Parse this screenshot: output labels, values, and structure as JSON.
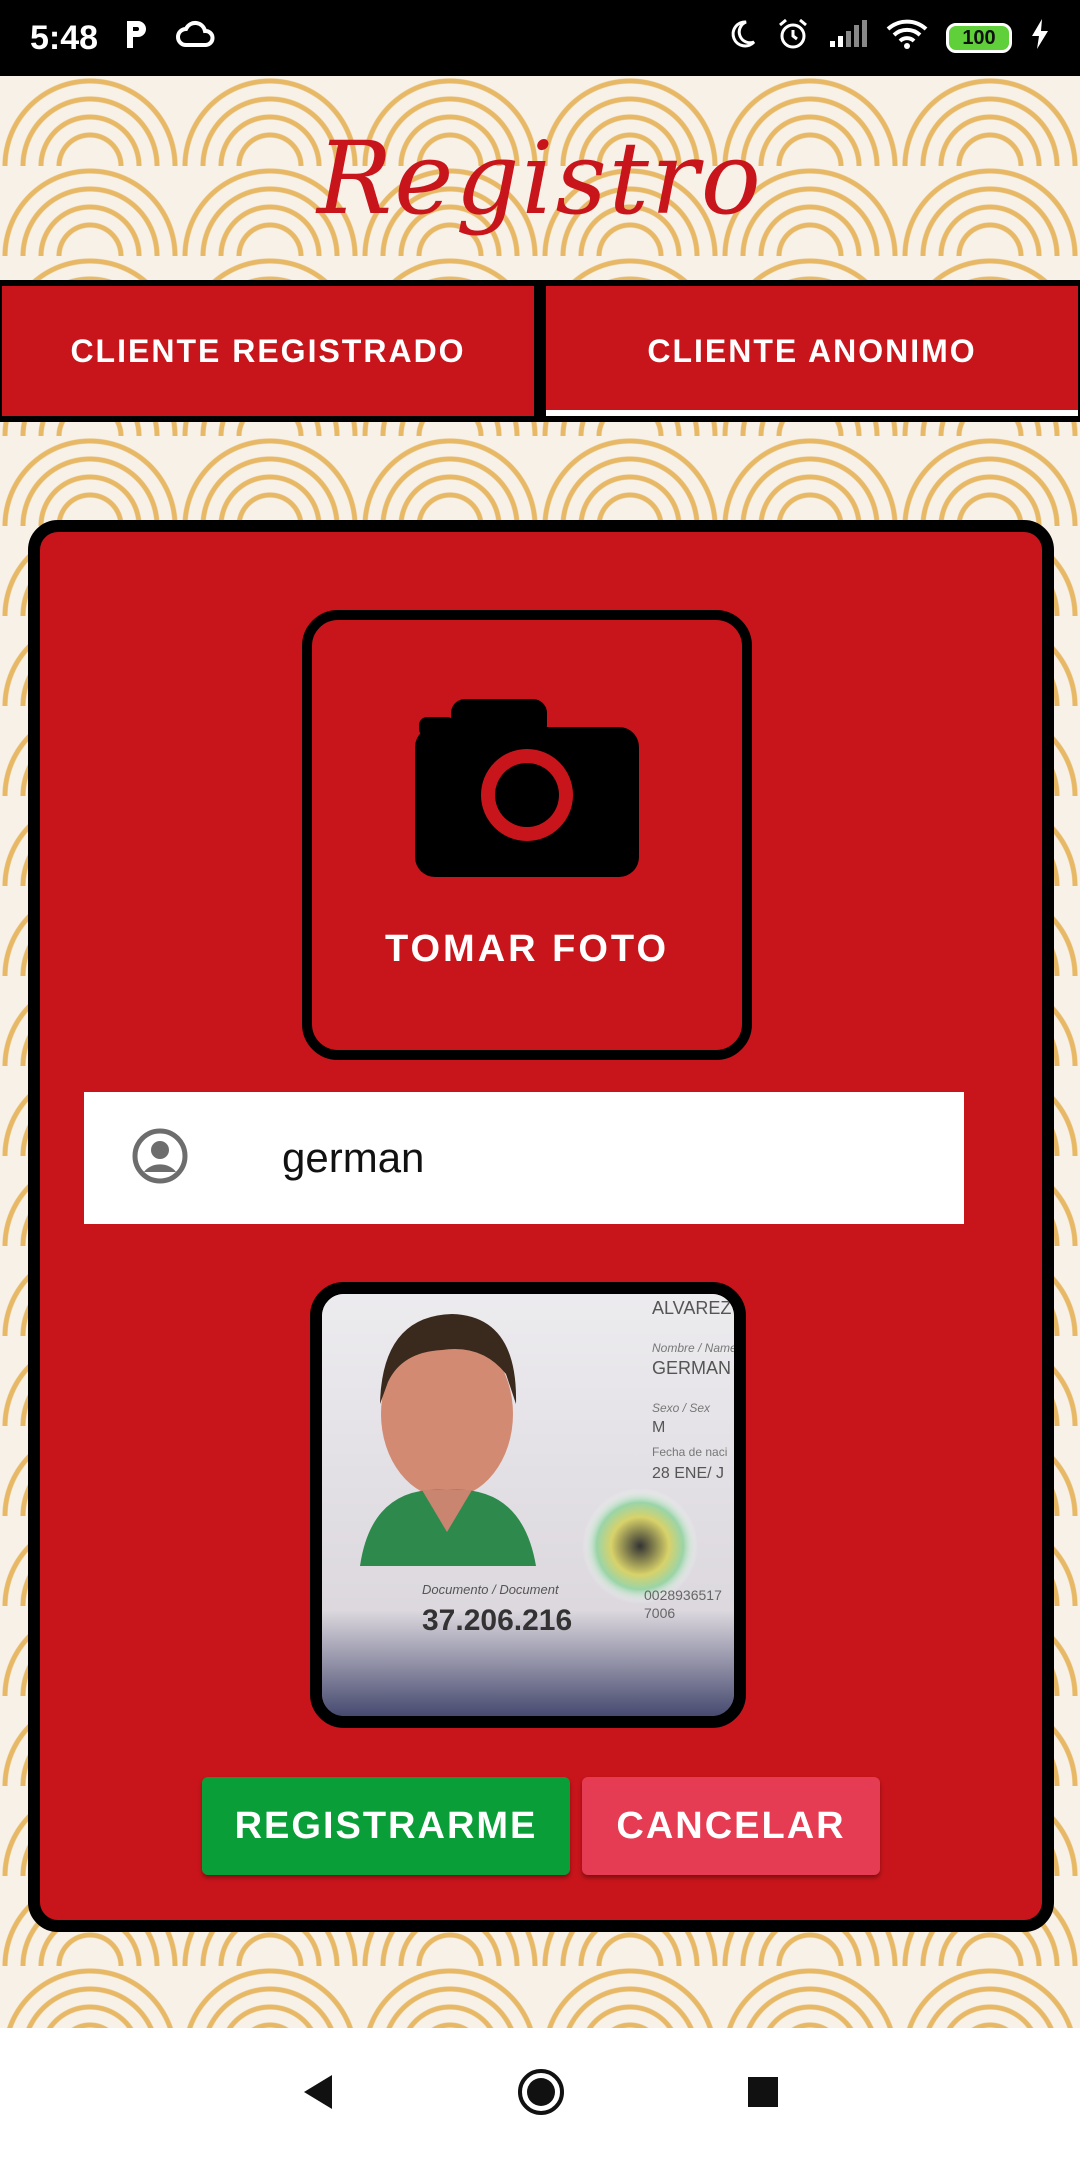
{
  "status_bar": {
    "time": "5:48",
    "battery": "100",
    "icons": [
      "parking-icon",
      "cloud-icon",
      "moon-icon",
      "alarm-icon",
      "signal-icon",
      "wifi-icon",
      "battery-icon",
      "charging-icon"
    ]
  },
  "header": {
    "title": "Registro"
  },
  "tabs": [
    {
      "label": "CLIENTE REGISTRADO",
      "selected": false
    },
    {
      "label": "CLIENTE ANONIMO",
      "selected": true
    }
  ],
  "form": {
    "photo_button_label": "TOMAR FOTO",
    "name_value": "german",
    "register_label": "REGISTRARME",
    "cancel_label": "CANCELAR"
  },
  "id_card": {
    "surname": "ALVAREZ",
    "name_label": "Nombre / Name",
    "name": "GERMAN",
    "sex_label": "Sexo / Sex",
    "sex": "M",
    "birth_label": "Fecha de naci",
    "birth": "28 ENE/ J",
    "document_label": "Documento / Document",
    "document": "37.206.216",
    "code": "0028936517",
    "code2": "7006"
  },
  "colors": {
    "primary_red": "#c8151b",
    "register_green": "#0a9e38",
    "cancel_pink": "#e53c54",
    "pattern_gold": "#e7b865"
  },
  "nav_bar": {
    "icons": [
      "back-icon",
      "home-icon",
      "recents-icon"
    ]
  }
}
